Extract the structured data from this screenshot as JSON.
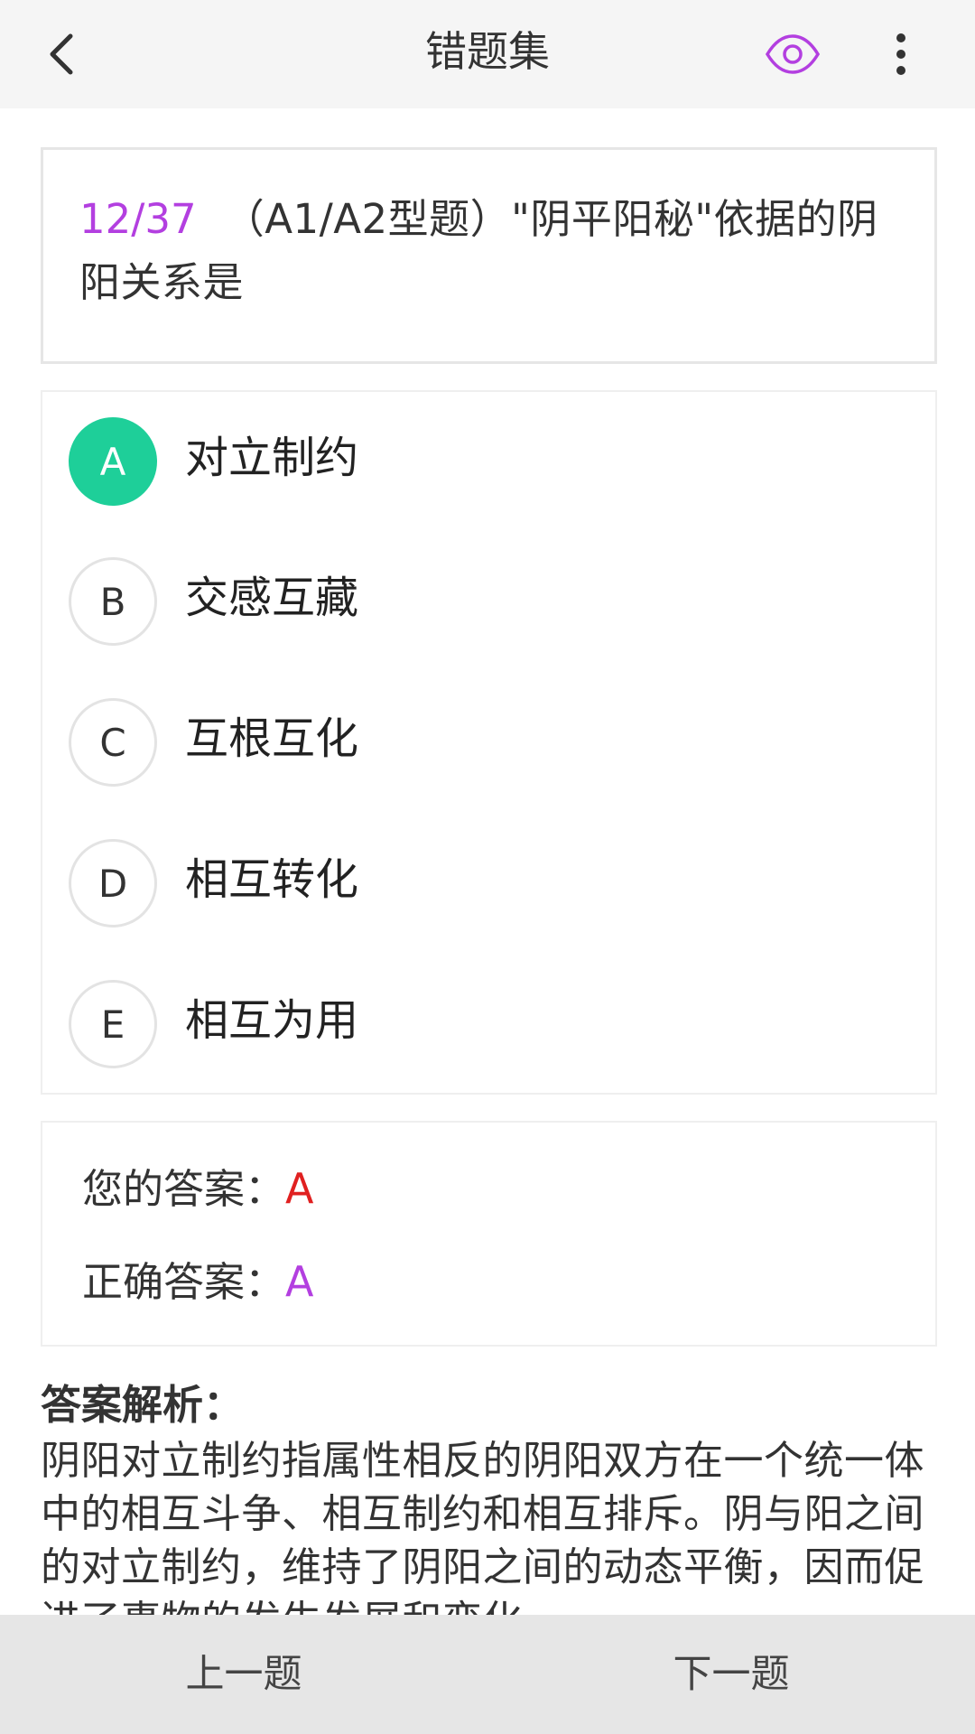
{
  "header": {
    "title": "错题集",
    "accent_color": "#b33fe0",
    "icons": [
      "chevron-left-icon",
      "eye-icon",
      "more-vertical-icon"
    ]
  },
  "question": {
    "progress": "12/37",
    "stem": "（A1/A2型题）\"阴平阳秘\"依据的阴阳关系是"
  },
  "options": [
    {
      "letter": "A",
      "text": "对立制约",
      "selected": true
    },
    {
      "letter": "B",
      "text": "交感互藏",
      "selected": false
    },
    {
      "letter": "C",
      "text": "互根互化",
      "selected": false
    },
    {
      "letter": "D",
      "text": "相互转化",
      "selected": false
    },
    {
      "letter": "E",
      "text": "相互为用",
      "selected": false
    }
  ],
  "answer": {
    "yours_label": "您的答案：",
    "yours_value": "A",
    "yours_color": "#e02020",
    "correct_label": "正确答案：",
    "correct_value": "A",
    "correct_color": "#b33fe0"
  },
  "explanation": {
    "heading": "答案解析：",
    "body": "阴阳对立制约指属性相反的阴阳双方在一个统一体中的相互斗争、相互制约和相互排斥。阴与阳之间的对立制约，维持了阴阳之间的动态平衡，因而促进了事物的发生发展和变化。"
  },
  "bottom_nav": {
    "prev_label": "上一题",
    "next_label": "下一题"
  },
  "colors": {
    "selected_option": "#1ecf99"
  }
}
